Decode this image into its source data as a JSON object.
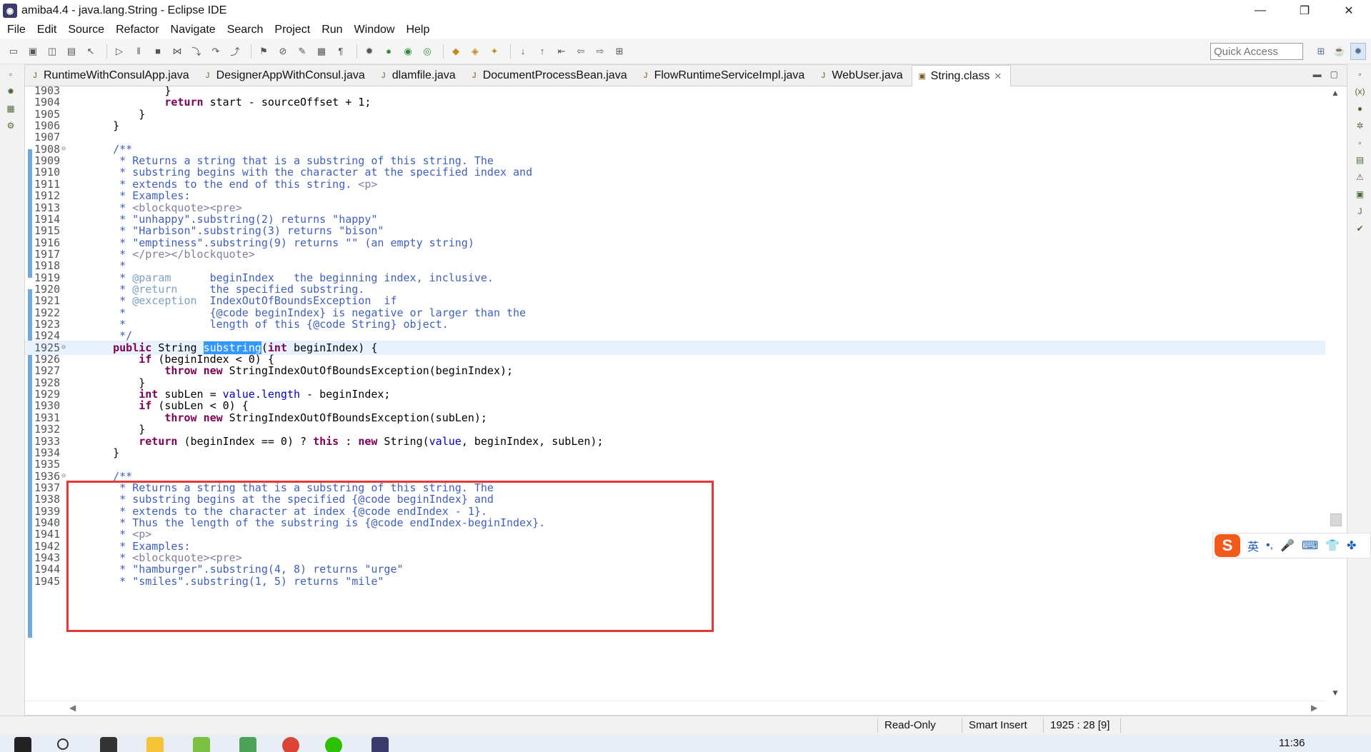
{
  "window": {
    "title": "amiba4.4 - java.lang.String - Eclipse IDE",
    "minimize": "—",
    "restore": "❐",
    "close": "✕"
  },
  "menu": [
    "File",
    "Edit",
    "Source",
    "Refactor",
    "Navigate",
    "Search",
    "Project",
    "Run",
    "Window",
    "Help"
  ],
  "toolbar": {
    "quick_access_placeholder": "Quick Access"
  },
  "tabs": [
    {
      "label": "RuntimeWithConsulApp.java",
      "icon": "java-file-icon",
      "active": false
    },
    {
      "label": "DesignerAppWithConsul.java",
      "icon": "java-file-icon",
      "active": false
    },
    {
      "label": "dlamfile.java",
      "icon": "java-file-icon",
      "active": false
    },
    {
      "label": "DocumentProcessBean.java",
      "icon": "java-file-icon",
      "active": false
    },
    {
      "label": "FlowRuntimeServiceImpl.java",
      "icon": "java-file-icon",
      "active": false
    },
    {
      "label": "WebUser.java",
      "icon": "java-file-icon",
      "active": false
    },
    {
      "label": "String.class",
      "icon": "class-file-icon",
      "active": true
    }
  ],
  "editor": {
    "current_line": "1925",
    "lines": [
      {
        "n": "1903",
        "t": "            }"
      },
      {
        "n": "1904",
        "t": "            return start - sourceOffset + 1;"
      },
      {
        "n": "1905",
        "t": "        }"
      },
      {
        "n": "1906",
        "t": "    }"
      },
      {
        "n": "1907",
        "t": ""
      },
      {
        "n": "1908",
        "t": "    /**",
        "fold": true
      },
      {
        "n": "1909",
        "t": "     * Returns a string that is a substring of this string. The"
      },
      {
        "n": "1910",
        "t": "     * substring begins with the character at the specified index and"
      },
      {
        "n": "1911",
        "t": "     * extends to the end of this string. <p>"
      },
      {
        "n": "1912",
        "t": "     * Examples:"
      },
      {
        "n": "1913",
        "t": "     * <blockquote><pre>"
      },
      {
        "n": "1914",
        "t": "     * \"unhappy\".substring(2) returns \"happy\""
      },
      {
        "n": "1915",
        "t": "     * \"Harbison\".substring(3) returns \"bison\""
      },
      {
        "n": "1916",
        "t": "     * \"emptiness\".substring(9) returns \"\" (an empty string)"
      },
      {
        "n": "1917",
        "t": "     * </pre></blockquote>"
      },
      {
        "n": "1918",
        "t": "     *"
      },
      {
        "n": "1919",
        "t": "     * @param      beginIndex   the beginning index, inclusive."
      },
      {
        "n": "1920",
        "t": "     * @return     the specified substring."
      },
      {
        "n": "1921",
        "t": "     * @exception  IndexOutOfBoundsException  if"
      },
      {
        "n": "1922",
        "t": "     *             {@code beginIndex} is negative or larger than the"
      },
      {
        "n": "1923",
        "t": "     *             length of this {@code String} object."
      },
      {
        "n": "1924",
        "t": "     */"
      },
      {
        "n": "1925",
        "t": "    public String substring(int beginIndex) {",
        "fold": true
      },
      {
        "n": "1926",
        "t": "        if (beginIndex < 0) {"
      },
      {
        "n": "1927",
        "t": "            throw new StringIndexOutOfBoundsException(beginIndex);"
      },
      {
        "n": "1928",
        "t": "        }"
      },
      {
        "n": "1929",
        "t": "        int subLen = value.length - beginIndex;"
      },
      {
        "n": "1930",
        "t": "        if (subLen < 0) {"
      },
      {
        "n": "1931",
        "t": "            throw new StringIndexOutOfBoundsException(subLen);"
      },
      {
        "n": "1932",
        "t": "        }"
      },
      {
        "n": "1933",
        "t": "        return (beginIndex == 0) ? this : new String(value, beginIndex, subLen);"
      },
      {
        "n": "1934",
        "t": "    }"
      },
      {
        "n": "1935",
        "t": ""
      },
      {
        "n": "1936",
        "t": "    /**",
        "fold": true
      },
      {
        "n": "1937",
        "t": "     * Returns a string that is a substring of this string. The"
      },
      {
        "n": "1938",
        "t": "     * substring begins at the specified {@code beginIndex} and"
      },
      {
        "n": "1939",
        "t": "     * extends to the character at index {@code endIndex - 1}."
      },
      {
        "n": "1940",
        "t": "     * Thus the length of the substring is {@code endIndex-beginIndex}."
      },
      {
        "n": "1941",
        "t": "     * <p>"
      },
      {
        "n": "1942",
        "t": "     * Examples:"
      },
      {
        "n": "1943",
        "t": "     * <blockquote><pre>"
      },
      {
        "n": "1944",
        "t": "     * \"hamburger\".substring(4, 8) returns \"urge\""
      },
      {
        "n": "1945",
        "t": "     * \"smiles\".substring(1, 5) returns \"mile\""
      }
    ]
  },
  "ime": {
    "logo": "S",
    "lang": "英",
    "punct": "•,",
    "mic": "🎤",
    "keyboard": "⌨",
    "skin": "👕",
    "grid": "✤"
  },
  "status": {
    "readonly": "Read-Only",
    "insert_mode": "Smart Insert",
    "position": "1925 : 28 [9]"
  },
  "taskbar": {
    "clock": "11:36"
  },
  "colors": {
    "keyword": "#7f0055",
    "comment": "#3f5fbf",
    "selection": "#3399ff",
    "highlight_box": "#e53935"
  }
}
